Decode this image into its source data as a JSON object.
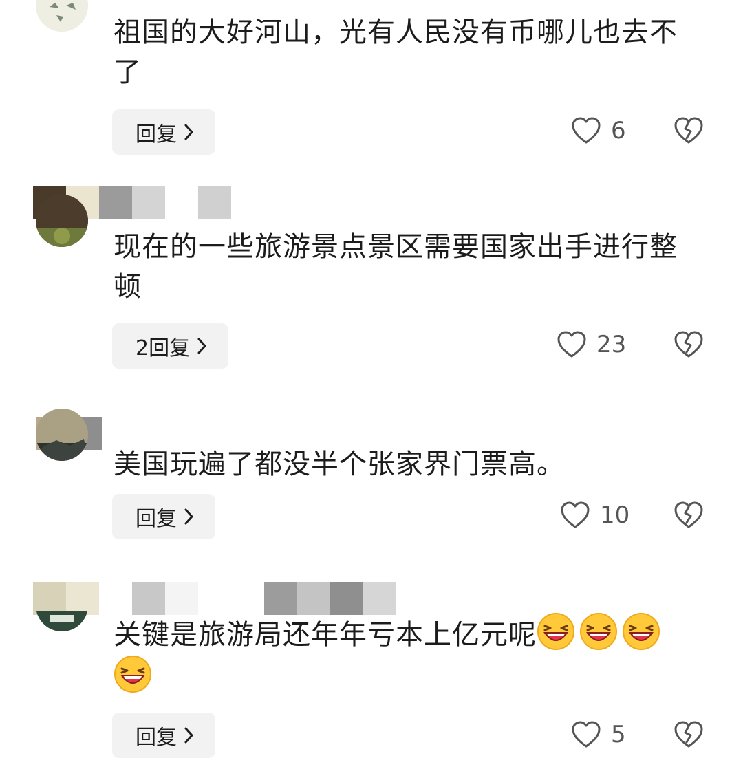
{
  "comments": [
    {
      "text": "祖国的大好河山，光有人民没有币哪儿也去不了",
      "reply_label": "回复",
      "likes": "6"
    },
    {
      "text": "现在的一些旅游景点景区需要国家出手进行整顿",
      "reply_label": "2回复",
      "likes": "23"
    },
    {
      "text": "美国玩遍了都没半个张家界门票高。",
      "reply_label": "回复",
      "likes": "10"
    },
    {
      "text": "关键是旅游局还年年亏本上亿元呢",
      "emoji_count": 4,
      "emoji": "laughing-face",
      "reply_label": "回复",
      "likes": "5"
    }
  ],
  "icons": {
    "like": "heart-outline-icon",
    "dislike": "broken-heart-icon",
    "reply_chevron": "chevron-right-icon"
  },
  "colors": {
    "background": "#ffffff",
    "text": "#1c1c1c",
    "count": "#555555",
    "reply_bg": "#f2f2f2",
    "emoji_face": "#ffc93a",
    "emoji_mouth": "#e5344a"
  }
}
